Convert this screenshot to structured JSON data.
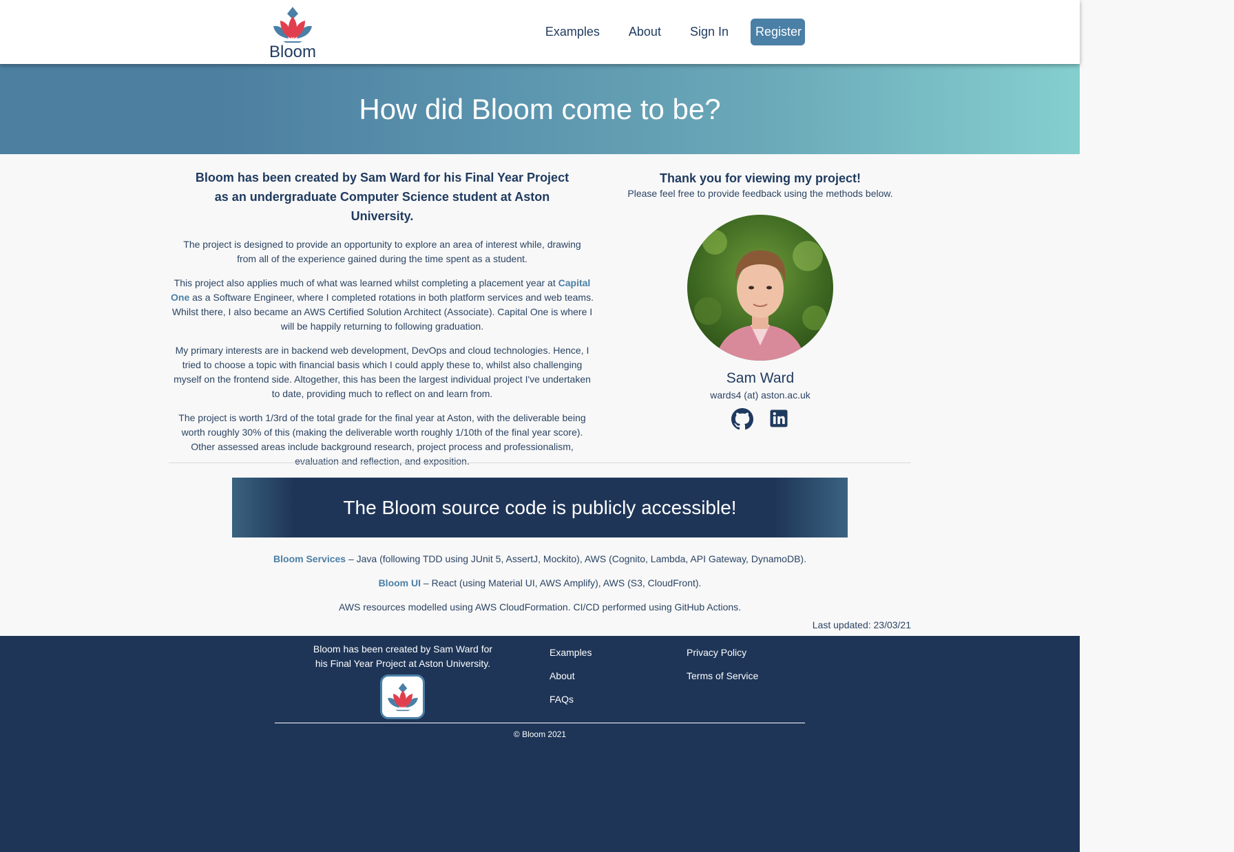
{
  "brand": {
    "name": "Bloom",
    "accent": "#4a7fa6",
    "navy": "#1e3557",
    "petal": "#e0404e"
  },
  "nav": {
    "examples": "Examples",
    "about": "About",
    "sign_in": "Sign In",
    "register": "Register"
  },
  "hero": {
    "title": "How did Bloom come to be?"
  },
  "intro": {
    "heading": "Bloom has been created by Sam Ward for his Final Year Project as an undergraduate Computer Science student at Aston University.",
    "p1": "The project is designed to provide an opportunity to explore an area of interest while, drawing from all of the experience gained during the time spent as a student.",
    "p2_before": "This project also applies much of what was learned whilst completing a placement year at ",
    "p2_link": "Capital One",
    "p2_after": " as a Software Engineer, where I completed rotations in both platform services and web teams. Whilst there, I also became an AWS Certified Solution Architect (Associate). Capital One is where I will be happily returning to following graduation.",
    "p3": "My primary interests are in backend web development, DevOps and cloud technologies. Hence, I tried to choose a topic with financial basis which I could apply these to, whilst also challenging myself on the frontend side. Altogether, this has been the largest individual project I've undertaken to date, providing much to reflect on and learn from.",
    "p4": "The project is worth 1/3rd of the total grade for the final year at Aston, with the deliverable being worth roughly 30% of this (making the deliverable worth roughly 1/10th of the final year score). Other assessed areas include background research, project process and professionalism, evaluation and reflection, and exposition."
  },
  "profile": {
    "thanks": "Thank you for viewing my project!",
    "feedback": "Please feel free to provide feedback using the methods below.",
    "name": "Sam Ward",
    "email": "wards4 (at) aston.ac.uk",
    "icons": [
      "github-icon",
      "linkedin-icon"
    ]
  },
  "source": {
    "banner": "The Bloom source code is publicly accessible!",
    "services_link": "Bloom Services",
    "services_text": " – Java (following TDD using JUnit 5, AssertJ, Mockito), AWS (Cognito, Lambda, API Gateway, DynamoDB).",
    "ui_link": "Bloom UI",
    "ui_text": " – React (using Material UI, AWS Amplify), AWS (S3, CloudFront).",
    "infra": "AWS resources modelled using AWS CloudFormation. CI/CD performed using GitHub Actions.",
    "updated": "Last updated: 23/03/21"
  },
  "footer": {
    "about": "Bloom has been created by Sam Ward for his Final Year Project at Aston University.",
    "col1": [
      "Examples",
      "About",
      "FAQs"
    ],
    "col2": [
      "Privacy Policy",
      "Terms of Service"
    ],
    "copyright": "© Bloom 2021"
  }
}
